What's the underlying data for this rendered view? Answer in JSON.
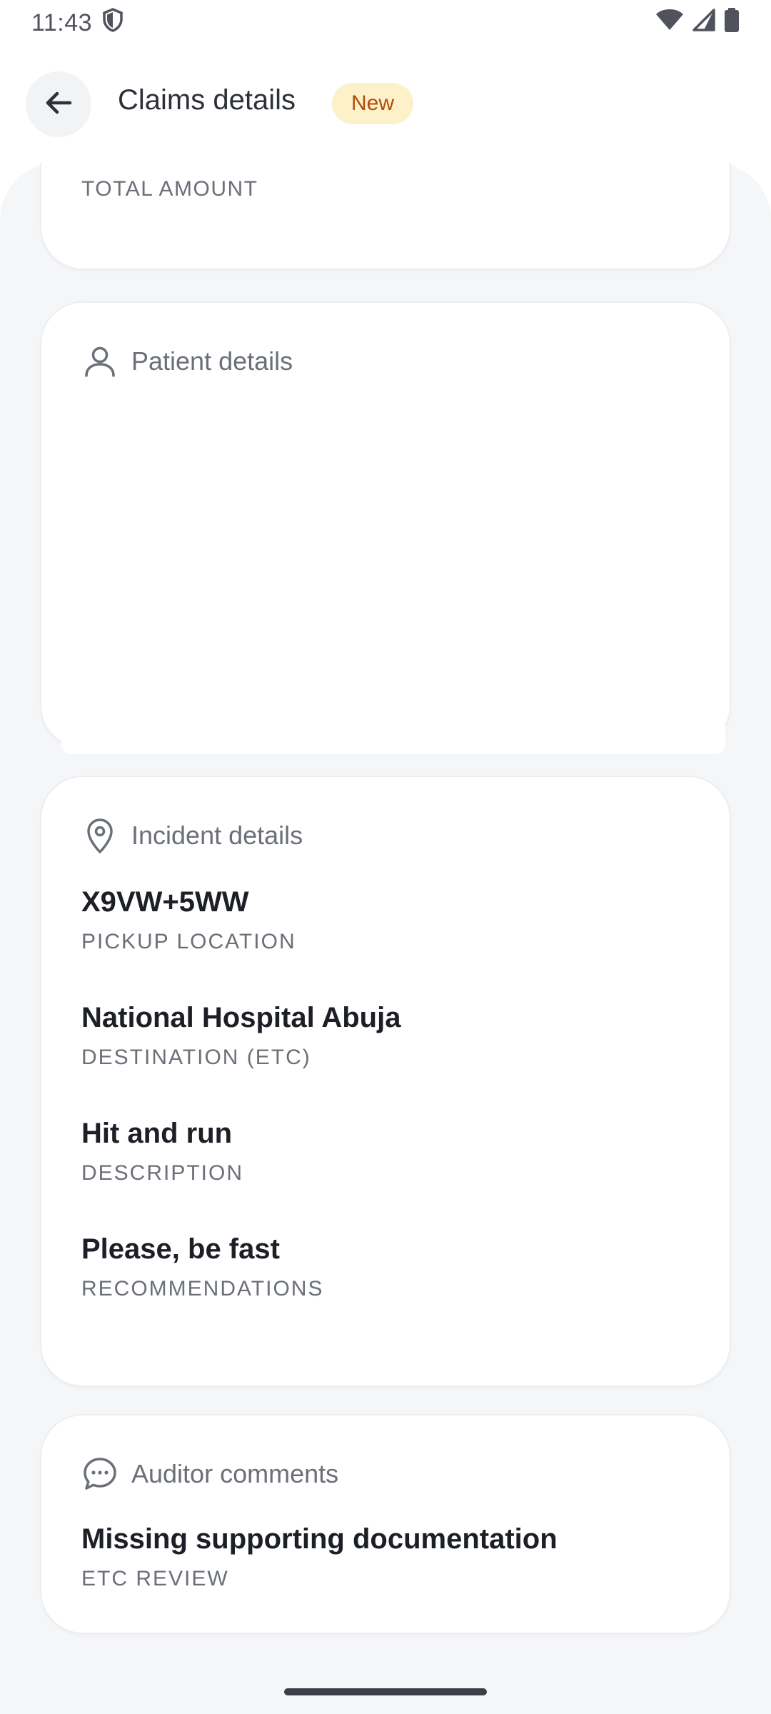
{
  "status_bar": {
    "time": "11:43",
    "icons": [
      "shield-icon",
      "wifi-icon",
      "signal-icon",
      "battery-icon"
    ]
  },
  "header": {
    "title": "Claims details",
    "badge": "New",
    "back_icon": "arrow-left-icon"
  },
  "amount_card": {
    "label": "TOTAL AMOUNT"
  },
  "patient_card": {
    "title": "Patient details",
    "icon": "person-icon"
  },
  "incident_card": {
    "title": "Incident details",
    "icon": "location-pin-icon",
    "fields": [
      {
        "value": "X9VW+5WW",
        "label": "PICKUP LOCATION"
      },
      {
        "value": "National Hospital Abuja",
        "label": "DESTINATION (ETC)"
      },
      {
        "value": "Hit and run",
        "label": "DESCRIPTION"
      },
      {
        "value": "Please, be fast",
        "label": "RECOMMENDATIONS"
      }
    ]
  },
  "auditor_card": {
    "title": "Auditor comments",
    "icon": "chat-bubble-icon",
    "fields": [
      {
        "value": "Missing supporting documentation",
        "label": "ETC REVIEW"
      }
    ]
  },
  "colors": {
    "badge_bg": "#fdf1c9",
    "badge_text": "#b54a0c",
    "card_bg": "#ffffff",
    "page_bg": "#f5f6f8"
  }
}
